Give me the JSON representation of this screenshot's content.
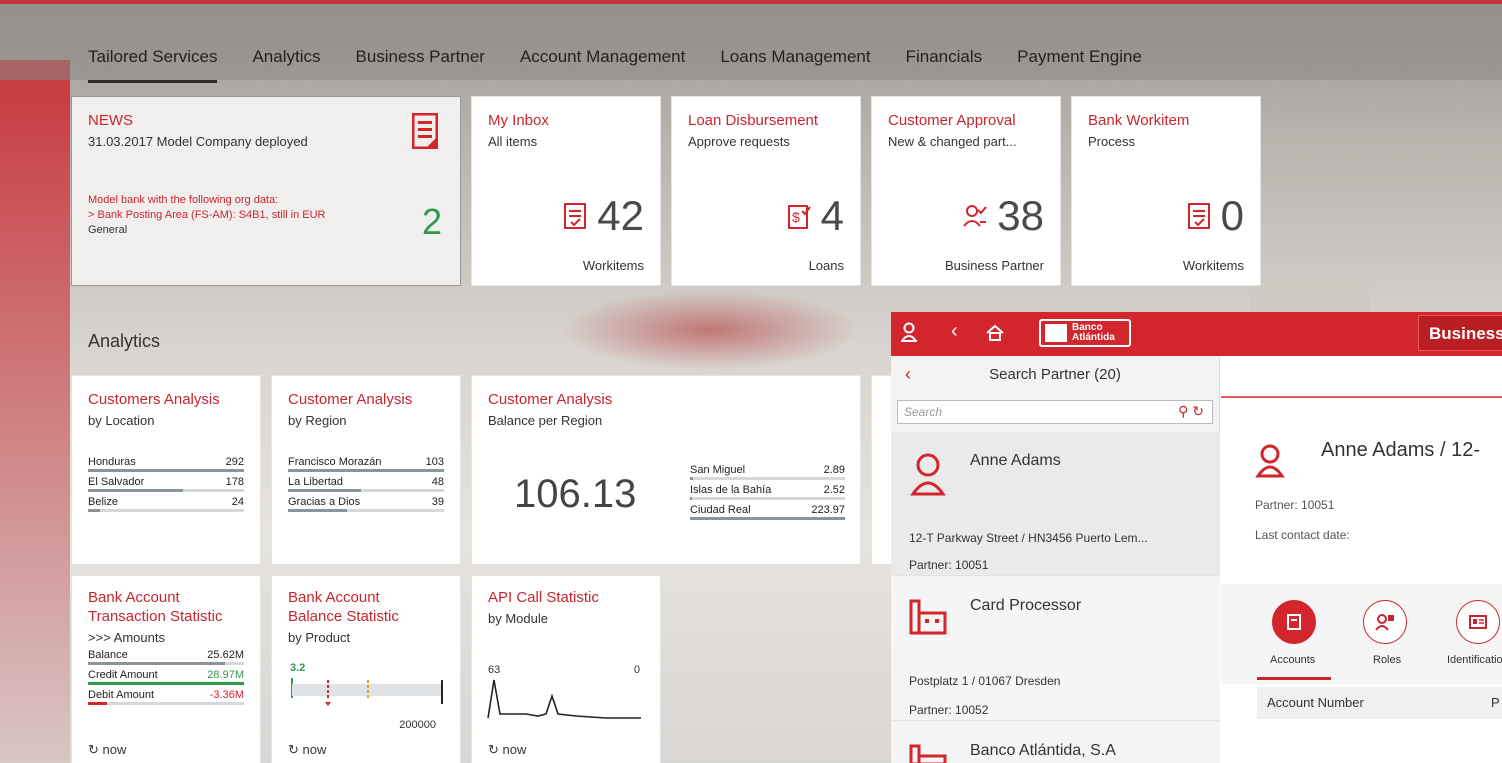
{
  "nav": {
    "tabs": [
      "Tailored Services",
      "Analytics",
      "Business Partner",
      "Account Management",
      "Loans Management",
      "Financials",
      "Payment Engine"
    ]
  },
  "tiles": {
    "news": {
      "title": "NEWS",
      "date": "31.03.2017 Model Company deployed",
      "line1": "Model bank with the following org data:",
      "line2": "> Bank Posting Area (FS-AM): S4B1, still in EUR",
      "footer": "General",
      "count": "2"
    },
    "inbox": {
      "title": "My Inbox",
      "subtitle": "All items",
      "value": "42",
      "footer": "Workitems"
    },
    "loan": {
      "title": "Loan Disbursement",
      "subtitle": "Approve requests",
      "value": "4",
      "footer": "Loans"
    },
    "approval": {
      "title": "Customer Approval",
      "subtitle": "New & changed part...",
      "value": "38",
      "footer": "Business Partner"
    },
    "workitem": {
      "title": "Bank Workitem",
      "subtitle": "Process",
      "value": "0",
      "footer": "Workitems"
    }
  },
  "analytics": {
    "heading": "Analytics",
    "location": {
      "title": "Customers Analysis",
      "subtitle": "by Location",
      "rows": [
        {
          "label": "Honduras",
          "value": "292",
          "pct": 100
        },
        {
          "label": "El Salvador",
          "value": "178",
          "pct": 61
        },
        {
          "label": "Belize",
          "value": "24",
          "pct": 8
        }
      ]
    },
    "region": {
      "title": "Customer Analysis",
      "subtitle": "by Region",
      "rows": [
        {
          "label": "Francisco Morazán",
          "value": "103",
          "pct": 100
        },
        {
          "label": "La Libertad",
          "value": "48",
          "pct": 47
        },
        {
          "label": "Gracias a Dios",
          "value": "39",
          "pct": 38
        }
      ]
    },
    "balance": {
      "title": "Customer Analysis",
      "subtitle": "Balance per Region",
      "big": "106.13",
      "rows": [
        {
          "label": "San Miguel",
          "value": "2.89",
          "pct": 2
        },
        {
          "label": "Islas de la Bahía",
          "value": "2.52",
          "pct": 1
        },
        {
          "label": "Ciudad Real",
          "value": "223.97",
          "pct": 100
        }
      ]
    },
    "transaction": {
      "title1": "Bank Account",
      "title2": "Transaction Statistic",
      "subtitle": ">>> Amounts",
      "rows": [
        {
          "label": "Balance",
          "value": "25.62M",
          "pct": 88,
          "color": "#8a9499"
        },
        {
          "label": "Credit Amount",
          "value": "28.97M",
          "pct": 100,
          "color": "#2e9a4a"
        },
        {
          "label": "Debit Amount",
          "value": "-3.36M",
          "pct": 12,
          "color": "#d3252c"
        }
      ],
      "refresh": "now"
    },
    "balancestat": {
      "title1": "Bank Account",
      "title2": "Balance Statistic",
      "subtitle": "by Product",
      "min": "3.2",
      "max": "200000",
      "refresh": "now"
    },
    "api": {
      "title": "API Call Statistic",
      "subtitle": "by Module",
      "left": "63",
      "right": "0",
      "refresh": "now"
    }
  },
  "app": {
    "logo_line1": "Banco",
    "logo_line2": "Atlántida",
    "business_btn": "Business",
    "search_title": "Search Partner (20)",
    "search_placeholder": "Search",
    "items": [
      {
        "name": "Anne Adams",
        "address": "12-T Parkway Street / HN3456 Puerto Lem...",
        "partner": "Partner: 10051"
      },
      {
        "name": "Card Processor",
        "address": "Postplatz 1 / 01067 Dresden",
        "partner": "Partner: 10052"
      },
      {
        "name": "Banco Atlántida, S.A"
      }
    ],
    "detail": {
      "name": "Anne Adams / 12-",
      "partner": "Partner: 10051",
      "contact": "Last contact date:",
      "tabs": [
        "Accounts",
        "Roles",
        "Identificatio"
      ],
      "col1": "Account Number",
      "col2": "P"
    }
  },
  "colors": {
    "brand": "#d3252c",
    "title": "#c8262e"
  }
}
